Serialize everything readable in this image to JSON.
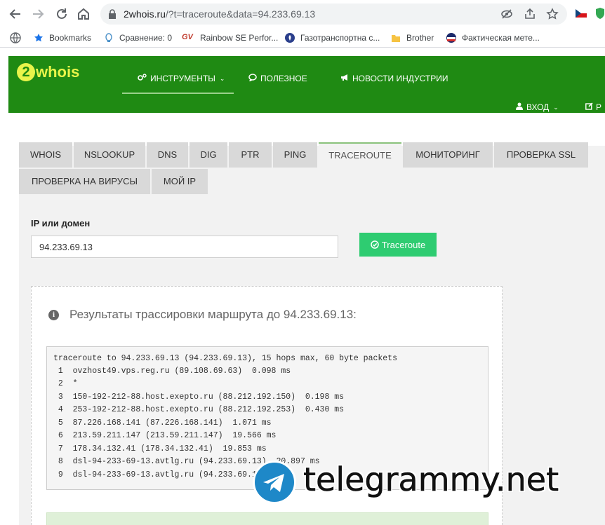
{
  "browser": {
    "url_host": "2whois.ru",
    "url_rest": "/?t=traceroute&data=94.233.69.13",
    "bookmarks": [
      {
        "label": "Bookmarks",
        "icon": "star-icon"
      },
      {
        "label": "Сравнение: 0",
        "icon": "bulb-icon"
      },
      {
        "label": "Rainbow SE Perfor...",
        "icon": "gv-logo-icon"
      },
      {
        "label": "Газотранспортна с...",
        "icon": "flame-icon"
      },
      {
        "label": "Brother",
        "icon": "folder-icon"
      },
      {
        "label": "Фактическая мете...",
        "icon": "weather-icon"
      }
    ]
  },
  "site": {
    "logo_digit": "2",
    "logo_text": "whois",
    "menu": [
      {
        "label": "ИНСТРУМЕНТЫ",
        "icon": "gears-icon"
      },
      {
        "label": "ПОЛЕЗНОЕ",
        "icon": "comment-icon"
      },
      {
        "label": "НОВОСТИ ИНДУСТРИИ",
        "icon": "megaphone-icon"
      }
    ],
    "login_label": "ВХОД",
    "register_label": "Р"
  },
  "tabs": [
    {
      "label": "WHOIS"
    },
    {
      "label": "NSLOOKUP"
    },
    {
      "label": "DNS"
    },
    {
      "label": "DIG"
    },
    {
      "label": "PTR"
    },
    {
      "label": "PING"
    },
    {
      "label": "TRACEROUTE",
      "active": true
    },
    {
      "label": "МОНИТОРИНГ"
    },
    {
      "label": "ПРОВЕРКА SSL"
    },
    {
      "label": "ПРОВЕРКА НА ВИРУСЫ"
    },
    {
      "label": "МОЙ IP"
    }
  ],
  "form": {
    "label": "IP или домен",
    "value": "94.233.69.13",
    "button_label": "Traceroute"
  },
  "result": {
    "title": "Результаты трассировки маршрута до 94.233.69.13:",
    "lines": [
      "traceroute to 94.233.69.13 (94.233.69.13), 15 hops max, 60 byte packets",
      " 1  ovzhost49.vps.reg.ru (89.108.69.63)  0.098 ms",
      " 2  *",
      " 3  150-192-212-88.host.exepto.ru (88.212.192.150)  0.198 ms",
      " 4  253-192-212-88.host.exepto.ru (88.212.192.253)  0.430 ms",
      " 5  87.226.168.141 (87.226.168.141)  1.071 ms",
      " 6  213.59.211.147 (213.59.211.147)  19.566 ms",
      " 7  178.34.132.41 (178.34.132.41)  19.853 ms",
      " 8  dsl-94-233-69-13.avtlg.ru (94.233.69.13)  20.897 ms",
      " 9  dsl-94-233-69-13.avtlg.ru (94.233.69.13)"
    ]
  },
  "watermark": {
    "text": "telegrammy.net"
  },
  "colors": {
    "header_green": "#1f8a13",
    "logo_yellow": "#e9f44a",
    "button_green": "#2ecc71",
    "tab_grey": "#d9d9d9"
  }
}
